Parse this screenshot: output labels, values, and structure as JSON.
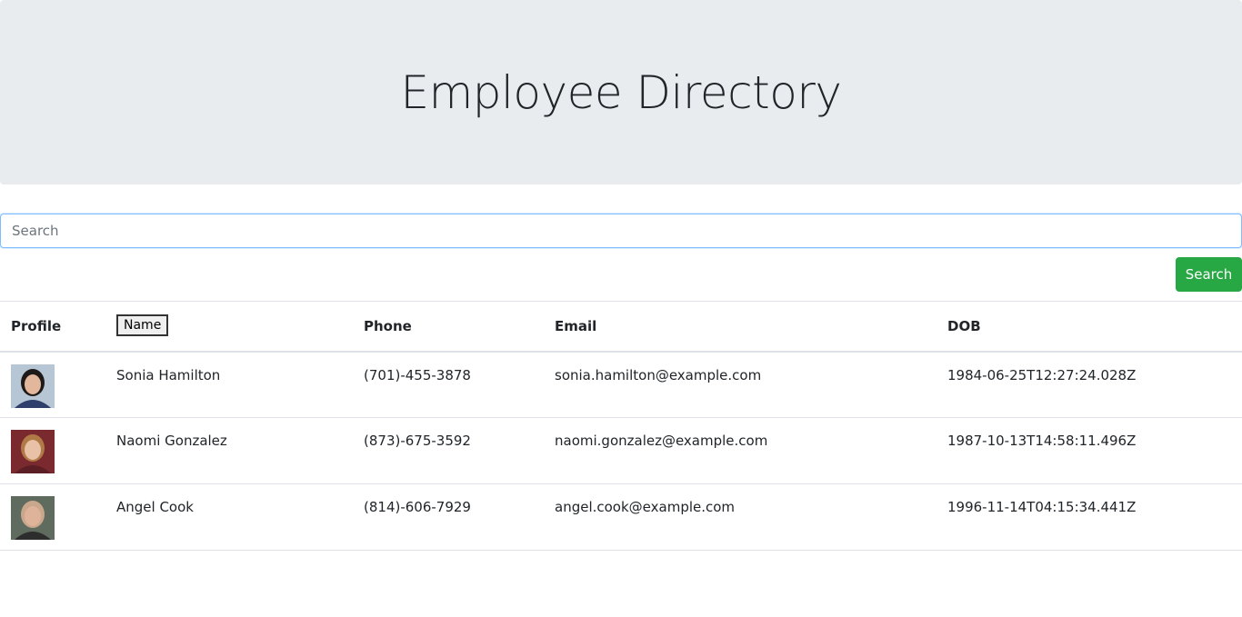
{
  "header": {
    "title": "Employee Directory"
  },
  "search": {
    "placeholder": "Search",
    "value": "",
    "button_label": "Search"
  },
  "table": {
    "columns": {
      "profile": "Profile",
      "name": "Name",
      "phone": "Phone",
      "email": "Email",
      "dob": "DOB"
    },
    "rows": [
      {
        "name": "Sonia Hamilton",
        "phone": "(701)-455-3878",
        "email": "sonia.hamilton@example.com",
        "dob": "1984-06-25T12:27:24.028Z",
        "avatar_colors": {
          "bg": "#b7c6d4",
          "hair": "#1f1a1a",
          "skin": "#e2b79b",
          "shirt": "#2e3f6b"
        }
      },
      {
        "name": "Naomi Gonzalez",
        "phone": "(873)-675-3592",
        "email": "naomi.gonzalez@example.com",
        "dob": "1987-10-13T14:58:11.496Z",
        "avatar_colors": {
          "bg": "#7a2a2e",
          "hair": "#b07a46",
          "skin": "#e8c1a6",
          "shirt": "#5a1e24"
        }
      },
      {
        "name": "Angel Cook",
        "phone": "(814)-606-7929",
        "email": "angel.cook@example.com",
        "dob": "1996-11-14T04:15:34.441Z",
        "avatar_colors": {
          "bg": "#5e6b5e",
          "hair": "#c9a78c",
          "skin": "#dfb39a",
          "shirt": "#2d2d2d"
        }
      }
    ]
  }
}
